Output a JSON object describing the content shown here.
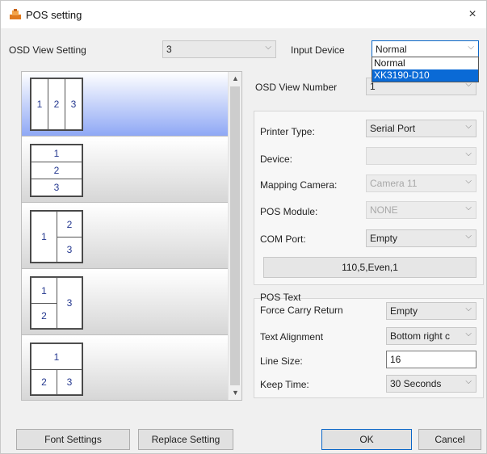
{
  "window": {
    "title": "POS setting",
    "close_glyph": "×"
  },
  "osd_view": {
    "label": "OSD View Setting",
    "value": "3"
  },
  "input_device": {
    "label": "Input Device",
    "value": "Normal",
    "options": [
      "Normal",
      "XK3190-D10"
    ],
    "highlighted_index": 1
  },
  "osd_view_number": {
    "label": "OSD View Number",
    "value": "1"
  },
  "layouts": [
    {
      "name": "layout-1x3",
      "cells": [
        "1",
        "2",
        "3"
      ],
      "selected": true
    },
    {
      "name": "layout-3-stacked",
      "cells": [
        "1",
        "2",
        "3"
      ],
      "selected": false
    },
    {
      "name": "layout-1-left-2-right",
      "cells": [
        "1",
        "2",
        "3"
      ],
      "selected": false
    },
    {
      "name": "layout-2-left-1-right",
      "cells": [
        "1",
        "2",
        "3"
      ],
      "selected": false
    },
    {
      "name": "layout-1-top-2-bottom",
      "cells": [
        "1",
        "2",
        "3"
      ],
      "selected": false
    }
  ],
  "printer": {
    "printer_type_label": "Printer Type:",
    "printer_type_value": "Serial Port",
    "device_label": "Device:",
    "device_value": "",
    "mapping_camera_label": "Mapping Camera:",
    "mapping_camera_value": "Camera 11",
    "pos_module_label": "POS Module:",
    "pos_module_value": "NONE",
    "com_port_label": "COM Port:",
    "com_port_value": "Empty",
    "com_settings": "110,5,Even,1"
  },
  "pos_text": {
    "group_label": "POS Text",
    "force_carry_label": "Force Carry Return",
    "force_carry_value": "Empty",
    "alignment_label": "Text Alignment",
    "alignment_value": "Bottom right c",
    "line_size_label": "Line Size:",
    "line_size_value": "16",
    "keep_time_label": "Keep Time:",
    "keep_time_value": "30 Seconds"
  },
  "buttons": {
    "font_settings": "Font Settings",
    "replace_setting": "Replace Setting",
    "ok": "OK",
    "cancel": "Cancel"
  },
  "icons": {
    "app": "pos-app-icon",
    "chevron": "chevron-down-icon",
    "scroll_up": "scroll-up-arrow",
    "scroll_down": "scroll-down-arrow"
  },
  "colors": {
    "accent": "#0a6ad6",
    "selected_tile": "#8fa8f5",
    "cell_text": "#23378f"
  }
}
